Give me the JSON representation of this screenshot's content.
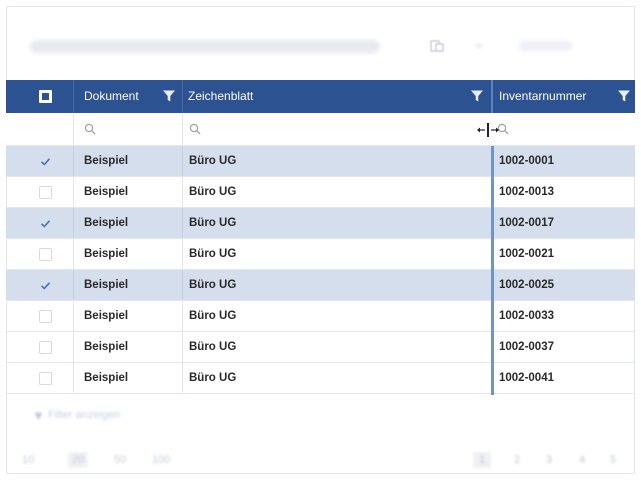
{
  "toolbar": {
    "title_blurred": "",
    "icon": "export-icon"
  },
  "grid": {
    "columns": [
      {
        "key": "select",
        "label": ""
      },
      {
        "key": "dokument",
        "label": "Dokument"
      },
      {
        "key": "zeichenblatt",
        "label": "Zeichenblatt"
      },
      {
        "key": "inventarnummer",
        "label": "Inventarnummer"
      }
    ],
    "header_color": "#2d5291",
    "selected_row_color": "#d4deec",
    "rows": [
      {
        "selected": true,
        "dokument": "Beispiel",
        "zeichenblatt": "Büro UG",
        "inventarnummer": "1002-0001"
      },
      {
        "selected": false,
        "dokument": "Beispiel",
        "zeichenblatt": "Büro UG",
        "inventarnummer": "1002-0013"
      },
      {
        "selected": true,
        "dokument": "Beispiel",
        "zeichenblatt": "Büro UG",
        "inventarnummer": "1002-0017"
      },
      {
        "selected": false,
        "dokument": "Beispiel",
        "zeichenblatt": "Büro UG",
        "inventarnummer": "1002-0021"
      },
      {
        "selected": true,
        "dokument": "Beispiel",
        "zeichenblatt": "Büro UG",
        "inventarnummer": "1002-0025"
      },
      {
        "selected": false,
        "dokument": "Beispiel",
        "zeichenblatt": "Büro UG",
        "inventarnummer": "1002-0033"
      },
      {
        "selected": false,
        "dokument": "Beispiel",
        "zeichenblatt": "Büro UG",
        "inventarnummer": "1002-0037"
      },
      {
        "selected": false,
        "dokument": "Beispiel",
        "zeichenblatt": "Büro UG",
        "inventarnummer": "1002-0041"
      }
    ]
  },
  "footer": {
    "filter_link": "Filter anzeigen",
    "page_sizes": [
      "10",
      "20",
      "50",
      "100"
    ],
    "active_page_size": "20",
    "pages": [
      "1",
      "2",
      "3",
      "4",
      "5"
    ],
    "active_page": "1"
  }
}
